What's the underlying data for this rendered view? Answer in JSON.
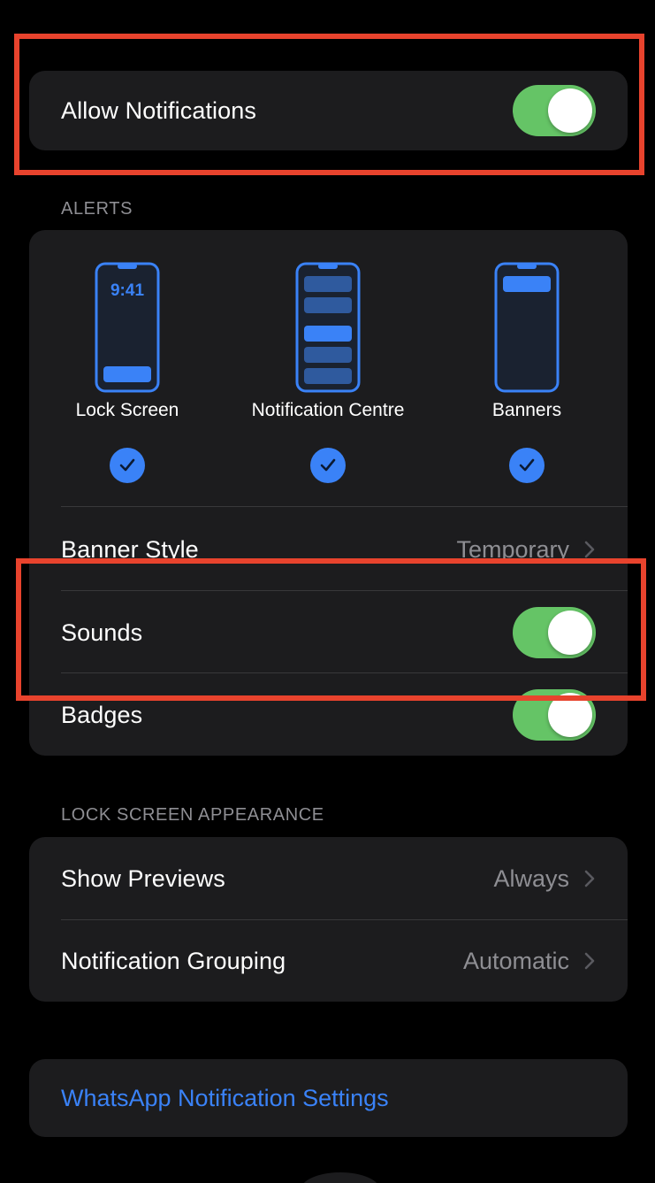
{
  "allow_notifications": {
    "label": "Allow Notifications",
    "enabled": true
  },
  "alerts": {
    "header": "ALERTS",
    "options": [
      {
        "label": "Lock Screen",
        "checked": true,
        "preview_time": "9:41"
      },
      {
        "label": "Notification Centre",
        "checked": true
      },
      {
        "label": "Banners",
        "checked": true
      }
    ],
    "banner_style": {
      "label": "Banner Style",
      "value": "Temporary"
    },
    "sounds": {
      "label": "Sounds",
      "enabled": true
    },
    "badges": {
      "label": "Badges",
      "enabled": true
    }
  },
  "lock_screen_appearance": {
    "header": "LOCK SCREEN APPEARANCE",
    "show_previews": {
      "label": "Show Previews",
      "value": "Always"
    },
    "notification_grouping": {
      "label": "Notification Grouping",
      "value": "Automatic"
    }
  },
  "app_settings_link": {
    "label": "WhatsApp Notification Settings"
  },
  "colors": {
    "background": "#000000",
    "card": "#1c1c1e",
    "toggle_on": "#65c466",
    "accent_blue": "#3a82f7",
    "highlight_red": "#e8432d",
    "secondary_text": "#8e8e93"
  }
}
